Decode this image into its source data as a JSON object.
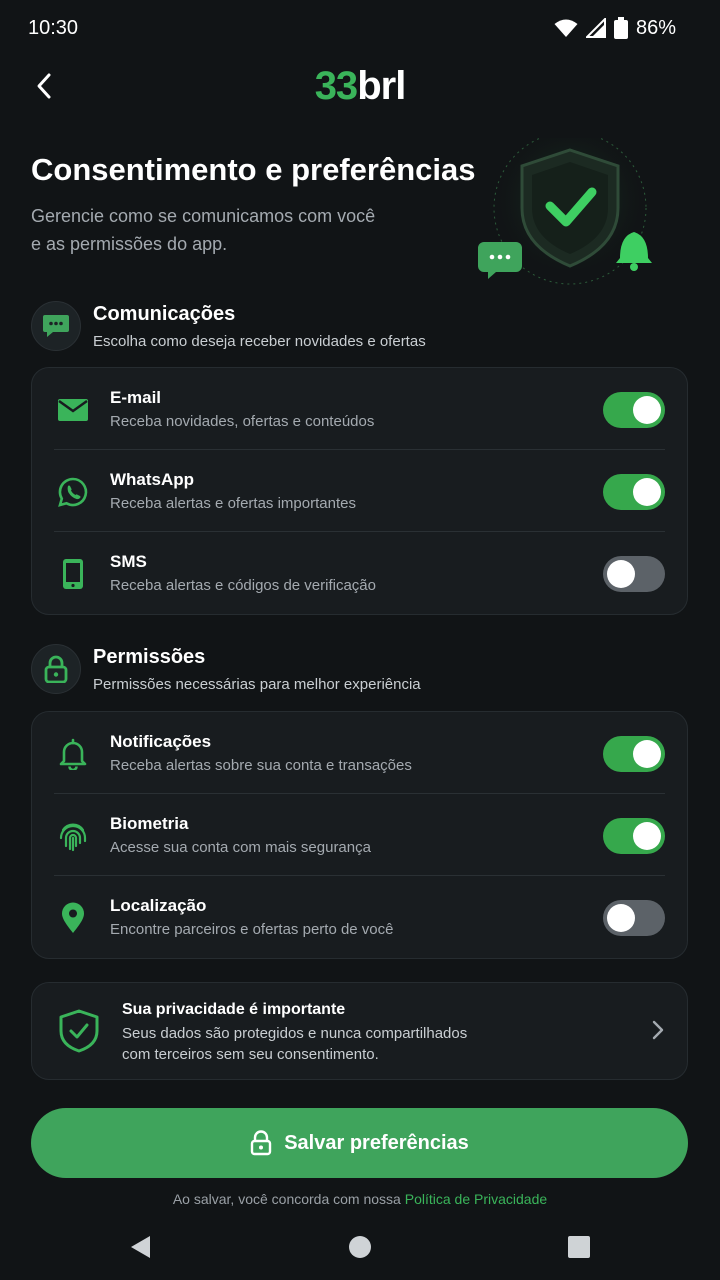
{
  "status": {
    "time": "10:30",
    "battery": "86%"
  },
  "header": {
    "logo_accent": "33",
    "logo_rest": "brl"
  },
  "hero": {
    "title": "Consentimento e preferências",
    "subtitle_line1": "Gerencie como se comunicamos com você",
    "subtitle_line2": "e as permissões do app."
  },
  "communications": {
    "title": "Comunicações",
    "subtitle": "Escolha como deseja receber novidades e ofertas",
    "items": [
      {
        "title": "E-mail",
        "subtitle": "Receba novidades, ofertas e conteúdos",
        "enabled": true
      },
      {
        "title": "WhatsApp",
        "subtitle": "Receba alertas e ofertas importantes",
        "enabled": true
      },
      {
        "title": "SMS",
        "subtitle": "Receba alertas e códigos de verificação",
        "enabled": false
      }
    ]
  },
  "permissions": {
    "title": "Permissões",
    "subtitle": "Permissões necessárias para melhor experiência",
    "items": [
      {
        "title": "Notificações",
        "subtitle": "Receba alertas sobre sua conta e transações",
        "enabled": true
      },
      {
        "title": "Biometria",
        "subtitle": "Acesse sua conta com mais segurança",
        "enabled": true
      },
      {
        "title": "Localização",
        "subtitle": "Encontre parceiros e ofertas perto de você",
        "enabled": false
      }
    ]
  },
  "privacy": {
    "title": "Sua privacidade é importante",
    "text_line1": "Seus dados são protegidos e nunca compartilhados",
    "text_line2": "com terceiros sem seu consentimento."
  },
  "save_button": {
    "label": "Salvar preferências"
  },
  "footer": {
    "note": "Ao salvar, você concorda com nossa ",
    "link": "Política de Privacidade"
  },
  "colors": {
    "accent": "#3ab45a",
    "button": "#3fa45c",
    "background": "#111416",
    "card": "#181c1f"
  },
  "icons": {
    "comm_section": "chat-bubble-icon",
    "perm_section": "lock-icon",
    "email": "mail-icon",
    "whatsapp": "whatsapp-icon",
    "sms": "phone-icon",
    "notifications": "bell-icon",
    "biometrics": "fingerprint-icon",
    "location": "location-pin-icon",
    "privacy": "shield-check-icon"
  }
}
